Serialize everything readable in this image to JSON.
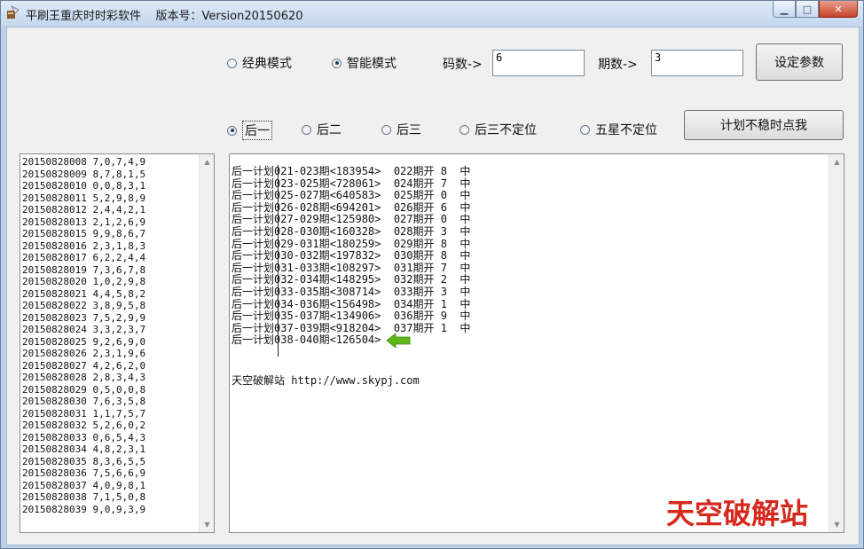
{
  "window": {
    "title": "平刷王重庆时时彩软件    版本号：Version20150620",
    "minimize": "▁",
    "maximize": "□",
    "close": "✕"
  },
  "modes": [
    {
      "label": "经典模式",
      "selected": false
    },
    {
      "label": "智能模式",
      "selected": true
    }
  ],
  "params": {
    "codes_label": "码数->",
    "codes_value": "6",
    "periods_label": "期数->",
    "periods_value": "3",
    "set_button": "设定参数"
  },
  "positions": [
    {
      "label": "后一",
      "selected": true
    },
    {
      "label": "后二",
      "selected": false
    },
    {
      "label": "后三",
      "selected": false
    },
    {
      "label": "后三不定位",
      "selected": false
    },
    {
      "label": "五星不定位",
      "selected": false
    }
  ],
  "unstable_button": "计划不稳时点我",
  "history": [
    "20150828008 7,0,7,4,9",
    "20150828009 8,7,8,1,5",
    "20150828010 0,0,8,3,1",
    "20150828011 5,2,9,8,9",
    "20150828012 2,4,4,2,1",
    "20150828013 2,1,2,6,9",
    "20150828015 9,9,8,6,7",
    "20150828016 2,3,1,8,3",
    "20150828017 6,2,2,4,4",
    "20150828019 7,3,6,7,8",
    "20150828020 1,0,2,9,8",
    "20150828021 4,4,5,8,2",
    "20150828022 3,8,9,5,8",
    "20150828023 7,5,2,9,9",
    "20150828024 3,3,2,3,7",
    "20150828025 9,2,6,9,0",
    "20150828026 2,3,1,9,6",
    "20150828027 4,2,6,2,0",
    "20150828028 2,8,3,4,3",
    "20150828029 0,5,0,0,8",
    "20150828030 7,6,3,5,8",
    "20150828031 1,1,7,5,7",
    "20150828032 5,2,6,0,2",
    "20150828033 0,6,5,4,3",
    "20150828034 4,8,2,3,1",
    "20150828035 8,3,6,5,5",
    "20150828036 7,5,6,6,9",
    "20150828037 4,0,9,8,1",
    "20150828038 7,1,5,0,8",
    "20150828039 9,0,9,3,9"
  ],
  "plan_lines": [
    "后一计划021-023期<183954>  022期开 8  中",
    "后一计划023-025期<728061>  024期开 7  中",
    "后一计划025-027期<640583>  025期开 0  中",
    "后一计划026-028期<694201>  026期开 6  中",
    "后一计划027-029期<125980>  027期开 0  中",
    "后一计划028-030期<160328>  028期开 3  中",
    "后一计划029-031期<180259>  029期开 8  中",
    "后一计划030-032期<197832>  030期开 8  中",
    "后一计划031-033期<108297>  031期开 7  中",
    "后一计划032-034期<148295>  032期开 2  中",
    "后一计划033-035期<308714>  033期开 3  中",
    "后一计划034-036期<156498>  034期开 1  中",
    "后一计划035-037期<134906>  036期开 9  中",
    "后一计划037-039期<918204>  037期开 1  中",
    "后一计划038-040期<126504>"
  ],
  "site_line": "天空破解站 http://www.skypj.com",
  "watermark": "天空破解站",
  "icons": {
    "app": "app-icon",
    "next": "green-left-arrow-icon"
  },
  "colors": {
    "watermark": "#d6281c",
    "arrow": "#5fb51b"
  }
}
